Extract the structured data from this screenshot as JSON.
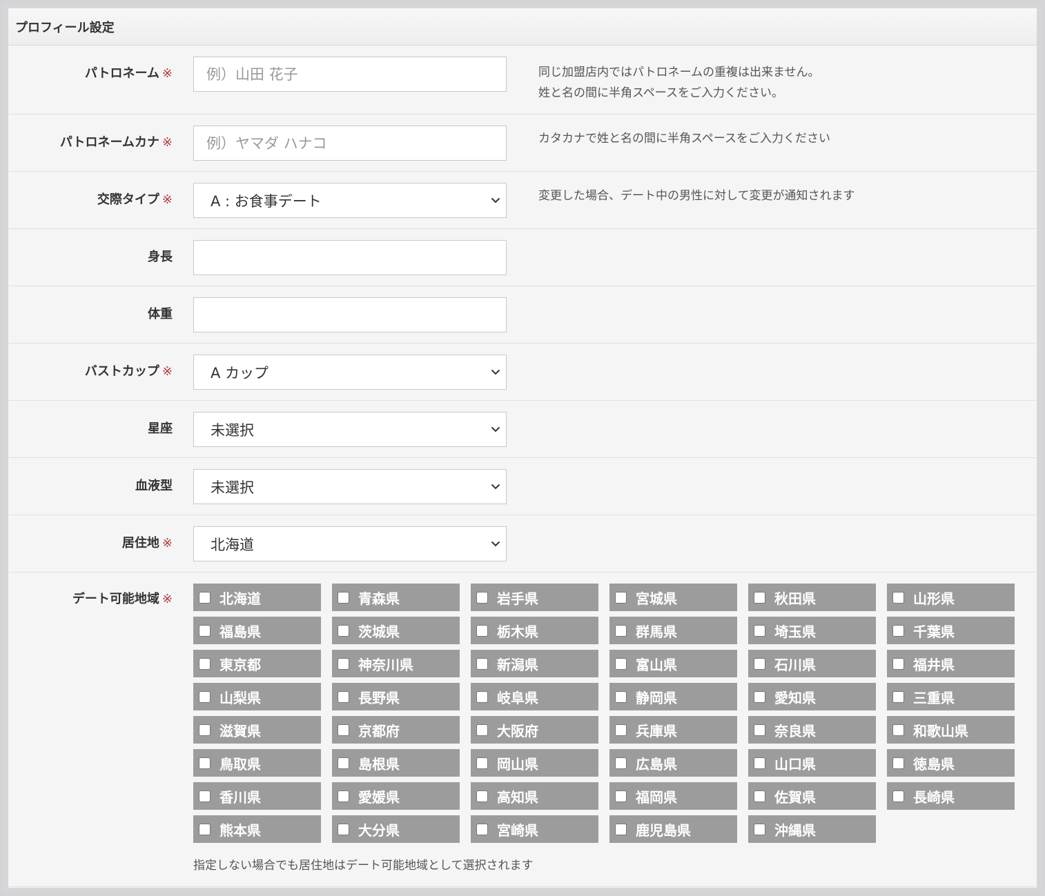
{
  "panel": {
    "title": "プロフィール設定"
  },
  "required_mark": "※",
  "fields": {
    "patron_name": {
      "label": "パトロネーム",
      "placeholder": "例）山田 花子",
      "value": "",
      "note_line1": "同じ加盟店内ではパトロネームの重複は出来ません。",
      "note_line2": "姓と名の間に半角スペースをご入力ください。"
    },
    "patron_kana": {
      "label": "パトロネームカナ",
      "placeholder": "例）ヤマダ ハナコ",
      "value": "",
      "note": "カタカナで姓と名の間に半角スペースをご入力ください"
    },
    "dating_type": {
      "label": "交際タイプ",
      "value": "A : お食事デート",
      "note": "変更した場合、デート中の男性に対して変更が通知されます"
    },
    "height": {
      "label": "身長",
      "value": ""
    },
    "weight": {
      "label": "体重",
      "value": ""
    },
    "bust_cup": {
      "label": "バストカップ",
      "value": "A カップ"
    },
    "zodiac": {
      "label": "星座",
      "value": "未選択"
    },
    "blood_type": {
      "label": "血液型",
      "value": "未選択"
    },
    "residence": {
      "label": "居住地",
      "value": "北海道"
    },
    "date_areas": {
      "label": "デート可能地域",
      "note": "指定しない場合でも居住地はデート可能地域として選択されます",
      "options": [
        "北海道",
        "青森県",
        "岩手県",
        "宮城県",
        "秋田県",
        "山形県",
        "福島県",
        "茨城県",
        "栃木県",
        "群馬県",
        "埼玉県",
        "千葉県",
        "東京都",
        "神奈川県",
        "新潟県",
        "富山県",
        "石川県",
        "福井県",
        "山梨県",
        "長野県",
        "岐阜県",
        "静岡県",
        "愛知県",
        "三重県",
        "滋賀県",
        "京都府",
        "大阪府",
        "兵庫県",
        "奈良県",
        "和歌山県",
        "鳥取県",
        "島根県",
        "岡山県",
        "広島県",
        "山口県",
        "徳島県",
        "香川県",
        "愛媛県",
        "高知県",
        "福岡県",
        "佐賀県",
        "長崎県",
        "熊本県",
        "大分県",
        "宮崎県",
        "鹿児島県",
        "沖縄県"
      ]
    }
  },
  "icons": {
    "select_arrow": "chevron-down-icon",
    "checkbox": "checkbox-icon"
  },
  "colors": {
    "required": "#b33a3a",
    "checkbox_bg": "#9c9c9c",
    "panel_bg": "#f5f5f5"
  }
}
